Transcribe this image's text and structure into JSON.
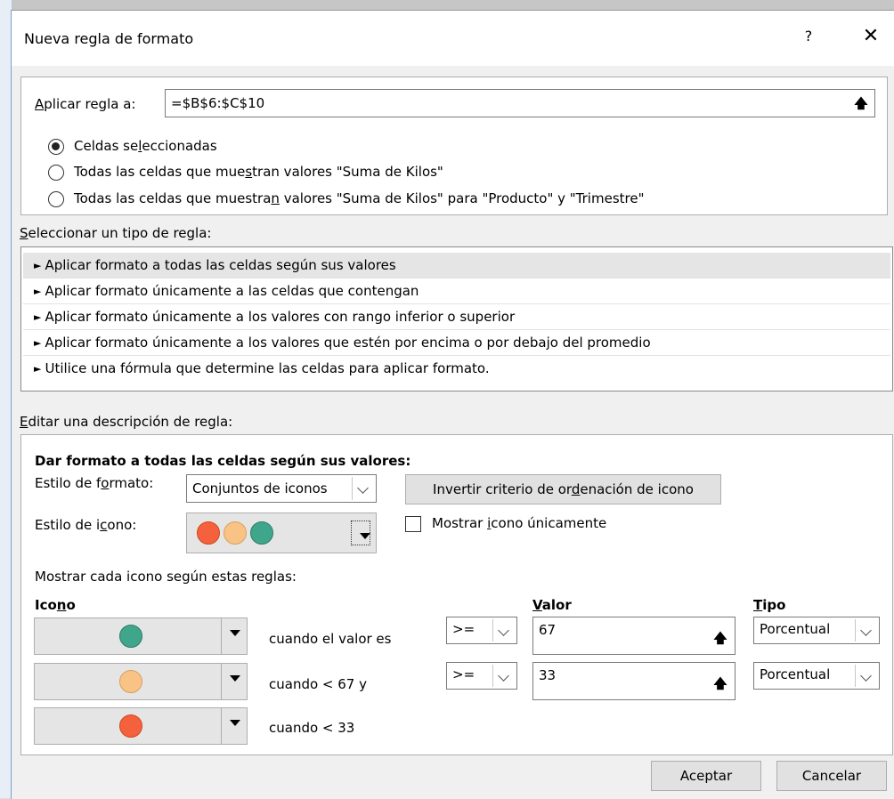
{
  "dialog": {
    "title": "Nueva regla de formato",
    "help": "?",
    "close": "✕"
  },
  "apply": {
    "label_pre": "",
    "label_u": "A",
    "label_post": "plicar regla a:",
    "value": "=$B$6:$C$10",
    "radios": [
      {
        "pre": "Celdas se",
        "u": "l",
        "post": "eccionadas",
        "checked": true
      },
      {
        "pre": "Todas las celdas que mue",
        "u": "s",
        "post": "tran valores \"Suma de Kilos\"",
        "checked": false
      },
      {
        "pre": "Todas las celdas que muestra",
        "u": "n",
        "post": " valores \"Suma de Kilos\" para \"Producto\" y \"Trimestre\"",
        "checked": false
      }
    ]
  },
  "rule_type": {
    "label_u": "S",
    "label_post": "eleccionar un tipo de regla:",
    "items": [
      "Aplicar formato a todas las celdas según sus valores",
      "Aplicar formato únicamente a las celdas que contengan",
      "Aplicar formato únicamente a los valores con rango inferior o superior",
      "Aplicar formato únicamente a los valores que estén por encima o por debajo del promedio",
      "Utilice una fórmula que determine las celdas para aplicar formato."
    ],
    "selected_index": 0
  },
  "edit": {
    "label_u": "E",
    "label_post": "ditar una descripción de regla:",
    "heading": "Dar formato a todas las celdas según sus valores:",
    "format_style": {
      "label_pre": "Estilo de f",
      "label_u": "o",
      "label_post": "rmato:",
      "value": "Conjuntos de iconos"
    },
    "reverse_button": {
      "pre": "Invertir criterio de or",
      "u": "d",
      "post": "enación de icono"
    },
    "icon_style": {
      "label_pre": "Estilo de i",
      "label_u": "c",
      "label_post": "ono:",
      "colors": [
        "#f4613c",
        "#f8c384",
        "#3fa68c"
      ]
    },
    "show_icon_only": {
      "pre": "Mostrar ",
      "u": "i",
      "post": "cono únicamente",
      "checked": false
    },
    "rules_caption": "Mostrar cada icono según estas reglas:",
    "col_icon": {
      "pre": "Ico",
      "u": "n",
      "post": "o"
    },
    "col_value": {
      "u": "V",
      "post": "alor"
    },
    "col_type": {
      "u": "T",
      "post": "ipo"
    },
    "rows": [
      {
        "icon": "green-circle",
        "color": "#3fa68c",
        "condition": "cuando el valor es",
        "operator": ">=",
        "value": "67",
        "type": "Porcentual"
      },
      {
        "icon": "yellow-circle",
        "color": "#f8c384",
        "condition": "cuando < 67 y",
        "operator": ">=",
        "value": "33",
        "type": "Porcentual"
      },
      {
        "icon": "red-circle",
        "color": "#f4613c",
        "condition": "cuando < 33"
      }
    ]
  },
  "buttons": {
    "ok": "Aceptar",
    "cancel": "Cancelar"
  }
}
